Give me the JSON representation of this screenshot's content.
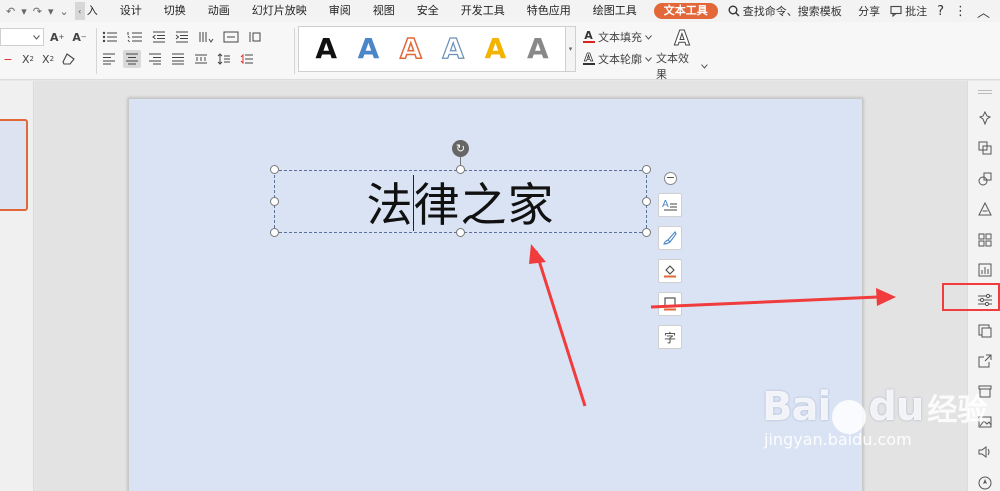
{
  "menubar": {
    "quick_access": [
      "↶",
      "▾",
      "↷",
      "▾",
      "⌄"
    ],
    "collapse": "‹",
    "tabs": [
      "插入",
      "设计",
      "切换",
      "动画",
      "幻灯片放映",
      "审阅",
      "视图",
      "安全",
      "开发工具",
      "特色应用",
      "绘图工具",
      "文本工具"
    ],
    "first_tab_visible": "入",
    "active_tab": "文本工具",
    "search_label": "查找命令、搜索模板",
    "share": "分享",
    "comment": "批注",
    "help": "?",
    "more": "⋮",
    "collapse_ribbon": "︿"
  },
  "ribbon": {
    "text_fill": "文本填充",
    "text_outline": "文本轮廓",
    "text_effect": "文本效果",
    "wordart_letter": "A"
  },
  "slide": {
    "textbox_text": "法律之家"
  },
  "float_tools": {
    "minus": "−",
    "char_label": "字"
  },
  "watermark": {
    "logo": "Bai",
    "logo_end": "du",
    "cn": "经验",
    "url": "jingyan.baidu.com"
  },
  "colors": {
    "accent": "#e2683a",
    "slide_bg": "#dae3f3",
    "arrow": "#f03c3c"
  }
}
